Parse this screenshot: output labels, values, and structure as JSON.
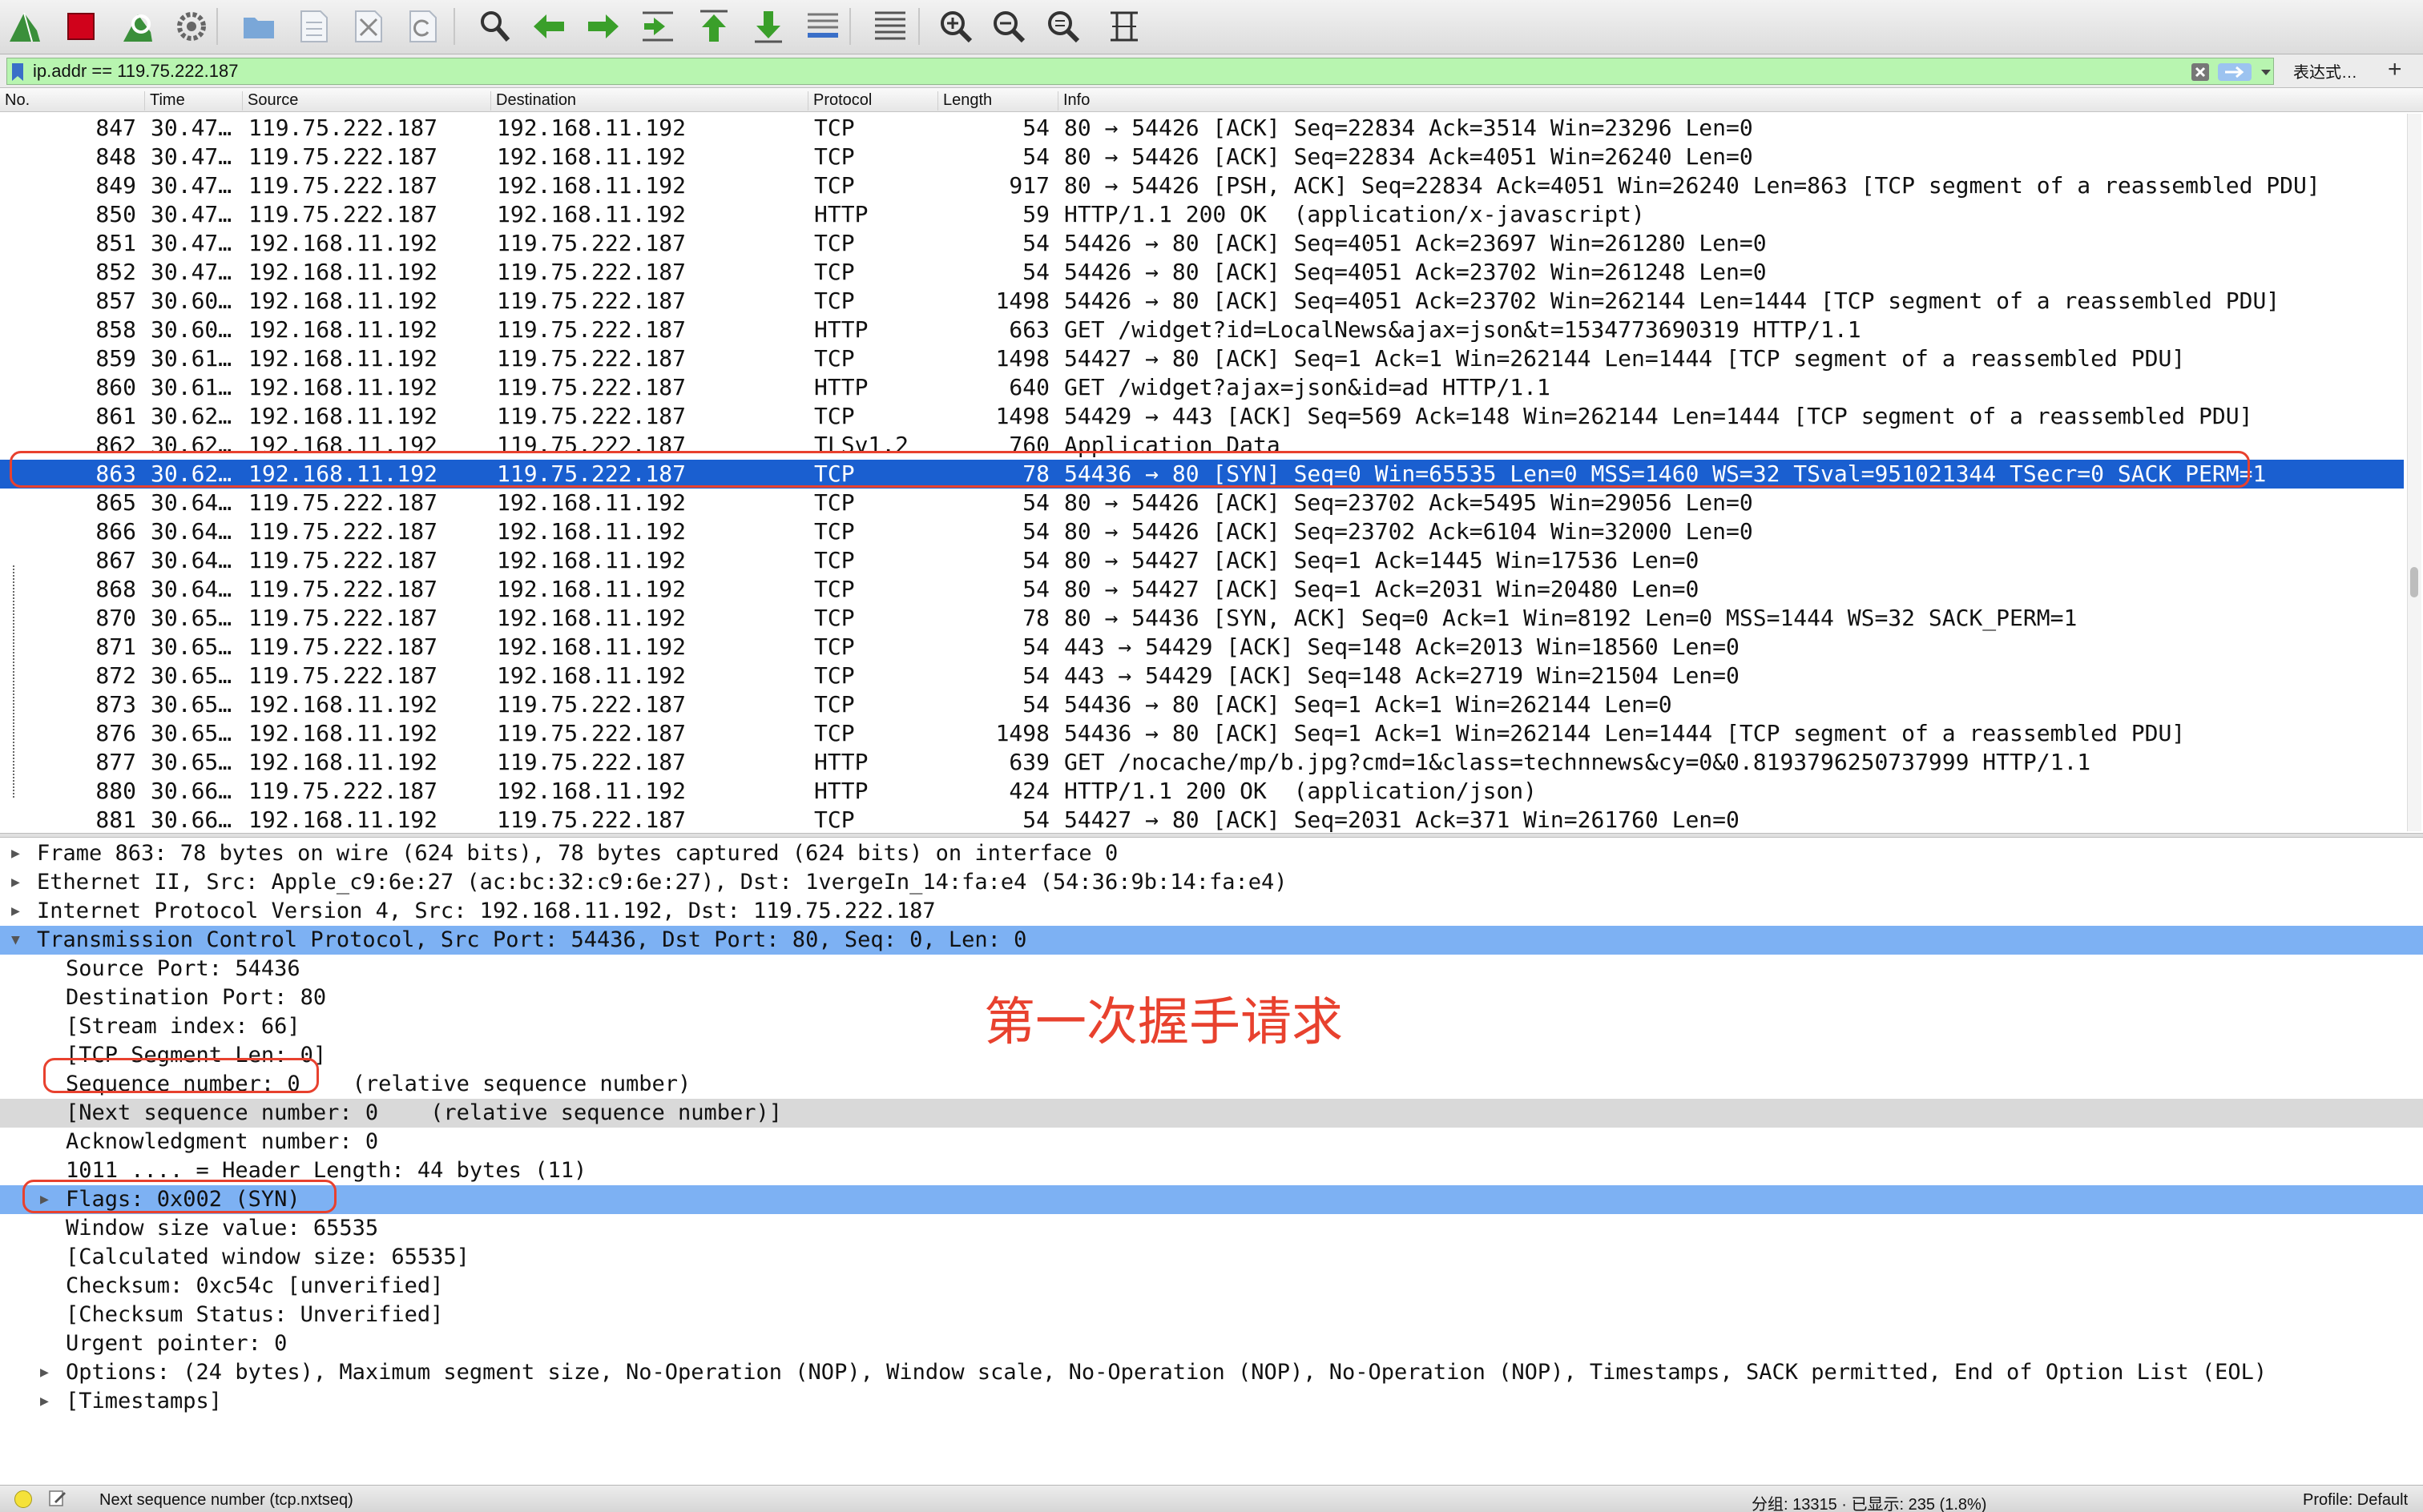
{
  "toolbar": {
    "buttons": [
      {
        "name": "start-capture-icon",
        "color": "#3a8f3a"
      },
      {
        "name": "stop-capture-icon",
        "color": "#d0021b"
      },
      {
        "name": "restart-capture-icon",
        "color": "#3a8f3a"
      },
      {
        "name": "capture-options-icon",
        "color": "#666666"
      },
      {
        "name": "open-file-icon",
        "color": "#7aa7d8"
      },
      {
        "name": "save-file-icon",
        "color": "#b0b8c4"
      },
      {
        "name": "close-file-icon",
        "color": "#b0b8c4"
      },
      {
        "name": "reload-file-icon",
        "color": "#b0b8c4"
      },
      {
        "name": "find-packet-icon",
        "color": "#333333"
      },
      {
        "name": "go-back-icon",
        "color": "#3a9f2a"
      },
      {
        "name": "go-forward-icon",
        "color": "#3a9f2a"
      },
      {
        "name": "go-to-packet-icon",
        "color": "#3a9f2a"
      },
      {
        "name": "first-packet-icon",
        "color": "#3a9f2a"
      },
      {
        "name": "last-packet-icon",
        "color": "#3a9f2a"
      },
      {
        "name": "auto-scroll-icon",
        "color": "#3a6fc8"
      },
      {
        "name": "colorize-icon",
        "color": "#555555"
      },
      {
        "name": "zoom-in-icon",
        "color": "#333333"
      },
      {
        "name": "zoom-out-icon",
        "color": "#333333"
      },
      {
        "name": "normal-size-icon",
        "color": "#333333"
      },
      {
        "name": "resize-columns-icon",
        "color": "#333333"
      }
    ]
  },
  "filter": {
    "value": "ip.addr == 119.75.222.187",
    "expression_label": "表达式…",
    "add_label": "+",
    "color": "#b8f5b0"
  },
  "packet_list": {
    "columns": [
      "No.",
      "Time",
      "Source",
      "Destination",
      "Protocol",
      "Length",
      "Info"
    ],
    "selected_color": "#1a5fd0",
    "rows": [
      {
        "no": "847",
        "time": "30.47…",
        "src": "119.75.222.187",
        "dst": "192.168.11.192",
        "proto": "TCP",
        "len": "54",
        "info": "80 → 54426 [ACK] Seq=22834 Ack=3514 Win=23296 Len=0"
      },
      {
        "no": "848",
        "time": "30.47…",
        "src": "119.75.222.187",
        "dst": "192.168.11.192",
        "proto": "TCP",
        "len": "54",
        "info": "80 → 54426 [ACK] Seq=22834 Ack=4051 Win=26240 Len=0"
      },
      {
        "no": "849",
        "time": "30.47…",
        "src": "119.75.222.187",
        "dst": "192.168.11.192",
        "proto": "TCP",
        "len": "917",
        "info": "80 → 54426 [PSH, ACK] Seq=22834 Ack=4051 Win=26240 Len=863 [TCP segment of a reassembled PDU]"
      },
      {
        "no": "850",
        "time": "30.47…",
        "src": "119.75.222.187",
        "dst": "192.168.11.192",
        "proto": "HTTP",
        "len": "59",
        "info": "HTTP/1.1 200 OK  (application/x-javascript)"
      },
      {
        "no": "851",
        "time": "30.47…",
        "src": "192.168.11.192",
        "dst": "119.75.222.187",
        "proto": "TCP",
        "len": "54",
        "info": "54426 → 80 [ACK] Seq=4051 Ack=23697 Win=261280 Len=0"
      },
      {
        "no": "852",
        "time": "30.47…",
        "src": "192.168.11.192",
        "dst": "119.75.222.187",
        "proto": "TCP",
        "len": "54",
        "info": "54426 → 80 [ACK] Seq=4051 Ack=23702 Win=261248 Len=0"
      },
      {
        "no": "857",
        "time": "30.60…",
        "src": "192.168.11.192",
        "dst": "119.75.222.187",
        "proto": "TCP",
        "len": "1498",
        "info": "54426 → 80 [ACK] Seq=4051 Ack=23702 Win=262144 Len=1444 [TCP segment of a reassembled PDU]"
      },
      {
        "no": "858",
        "time": "30.60…",
        "src": "192.168.11.192",
        "dst": "119.75.222.187",
        "proto": "HTTP",
        "len": "663",
        "info": "GET /widget?id=LocalNews&ajax=json&t=1534773690319 HTTP/1.1"
      },
      {
        "no": "859",
        "time": "30.61…",
        "src": "192.168.11.192",
        "dst": "119.75.222.187",
        "proto": "TCP",
        "len": "1498",
        "info": "54427 → 80 [ACK] Seq=1 Ack=1 Win=262144 Len=1444 [TCP segment of a reassembled PDU]"
      },
      {
        "no": "860",
        "time": "30.61…",
        "src": "192.168.11.192",
        "dst": "119.75.222.187",
        "proto": "HTTP",
        "len": "640",
        "info": "GET /widget?ajax=json&id=ad HTTP/1.1"
      },
      {
        "no": "861",
        "time": "30.62…",
        "src": "192.168.11.192",
        "dst": "119.75.222.187",
        "proto": "TCP",
        "len": "1498",
        "info": "54429 → 443 [ACK] Seq=569 Ack=148 Win=262144 Len=1444 [TCP segment of a reassembled PDU]"
      },
      {
        "no": "862",
        "time": "30.62…",
        "src": "192.168.11.192",
        "dst": "119.75.222.187",
        "proto": "TLSv1.2",
        "len": "760",
        "info": "Application Data"
      },
      {
        "no": "863",
        "time": "30.62…",
        "src": "192.168.11.192",
        "dst": "119.75.222.187",
        "proto": "TCP",
        "len": "78",
        "info": "54436 → 80 [SYN] Seq=0 Win=65535 Len=0 MSS=1460 WS=32 TSval=951021344 TSecr=0 SACK_PERM=1",
        "selected": true
      },
      {
        "no": "865",
        "time": "30.64…",
        "src": "119.75.222.187",
        "dst": "192.168.11.192",
        "proto": "TCP",
        "len": "54",
        "info": "80 → 54426 [ACK] Seq=23702 Ack=5495 Win=29056 Len=0"
      },
      {
        "no": "866",
        "time": "30.64…",
        "src": "119.75.222.187",
        "dst": "192.168.11.192",
        "proto": "TCP",
        "len": "54",
        "info": "80 → 54426 [ACK] Seq=23702 Ack=6104 Win=32000 Len=0"
      },
      {
        "no": "867",
        "time": "30.64…",
        "src": "119.75.222.187",
        "dst": "192.168.11.192",
        "proto": "TCP",
        "len": "54",
        "info": "80 → 54427 [ACK] Seq=1 Ack=1445 Win=17536 Len=0"
      },
      {
        "no": "868",
        "time": "30.64…",
        "src": "119.75.222.187",
        "dst": "192.168.11.192",
        "proto": "TCP",
        "len": "54",
        "info": "80 → 54427 [ACK] Seq=1 Ack=2031 Win=20480 Len=0"
      },
      {
        "no": "870",
        "time": "30.65…",
        "src": "119.75.222.187",
        "dst": "192.168.11.192",
        "proto": "TCP",
        "len": "78",
        "info": "80 → 54436 [SYN, ACK] Seq=0 Ack=1 Win=8192 Len=0 MSS=1444 WS=32 SACK_PERM=1"
      },
      {
        "no": "871",
        "time": "30.65…",
        "src": "119.75.222.187",
        "dst": "192.168.11.192",
        "proto": "TCP",
        "len": "54",
        "info": "443 → 54429 [ACK] Seq=148 Ack=2013 Win=18560 Len=0"
      },
      {
        "no": "872",
        "time": "30.65…",
        "src": "119.75.222.187",
        "dst": "192.168.11.192",
        "proto": "TCP",
        "len": "54",
        "info": "443 → 54429 [ACK] Seq=148 Ack=2719 Win=21504 Len=0"
      },
      {
        "no": "873",
        "time": "30.65…",
        "src": "192.168.11.192",
        "dst": "119.75.222.187",
        "proto": "TCP",
        "len": "54",
        "info": "54436 → 80 [ACK] Seq=1 Ack=1 Win=262144 Len=0"
      },
      {
        "no": "876",
        "time": "30.65…",
        "src": "192.168.11.192",
        "dst": "119.75.222.187",
        "proto": "TCP",
        "len": "1498",
        "info": "54436 → 80 [ACK] Seq=1 Ack=1 Win=262144 Len=1444 [TCP segment of a reassembled PDU]"
      },
      {
        "no": "877",
        "time": "30.65…",
        "src": "192.168.11.192",
        "dst": "119.75.222.187",
        "proto": "HTTP",
        "len": "639",
        "info": "GET /nocache/mp/b.jpg?cmd=1&class=technnews&cy=0&0.8193796250737999 HTTP/1.1"
      },
      {
        "no": "880",
        "time": "30.66…",
        "src": "119.75.222.187",
        "dst": "192.168.11.192",
        "proto": "HTTP",
        "len": "424",
        "info": "HTTP/1.1 200 OK  (application/json)"
      },
      {
        "no": "881",
        "time": "30.66…",
        "src": "192.168.11.192",
        "dst": "119.75.222.187",
        "proto": "TCP",
        "len": "54",
        "info": "54427 → 80 [ACK] Seq=2031 Ack=371 Win=261760 Len=0"
      }
    ]
  },
  "details": {
    "highlight_color": "#7db1f3",
    "rows": [
      {
        "text": "Frame 863: 78 bytes on wire (624 bits), 78 bytes captured (624 bits) on interface 0",
        "indent": 0,
        "expander": "collapsed"
      },
      {
        "text": "Ethernet II, Src: Apple_c9:6e:27 (ac:bc:32:c9:6e:27), Dst: 1vergeIn_14:fa:e4 (54:36:9b:14:fa:e4)",
        "indent": 0,
        "expander": "collapsed"
      },
      {
        "text": "Internet Protocol Version 4, Src: 192.168.11.192, Dst: 119.75.222.187",
        "indent": 0,
        "expander": "collapsed"
      },
      {
        "text": "Transmission Control Protocol, Src Port: 54436, Dst Port: 80, Seq: 0, Len: 0",
        "indent": 0,
        "expander": "expanded",
        "style": "hl"
      },
      {
        "text": "Source Port: 54436",
        "indent": 1
      },
      {
        "text": "Destination Port: 80",
        "indent": 1
      },
      {
        "text": "[Stream index: 66]",
        "indent": 1
      },
      {
        "text": "[TCP Segment Len: 0]",
        "indent": 1
      },
      {
        "text": "Sequence number: 0    (relative sequence number)",
        "indent": 1
      },
      {
        "text": "[Next sequence number: 0    (relative sequence number)]",
        "indent": 1,
        "style": "gray"
      },
      {
        "text": "Acknowledgment number: 0",
        "indent": 1
      },
      {
        "text": "1011 .... = Header Length: 44 bytes (11)",
        "indent": 1
      },
      {
        "text": "Flags: 0x002 (SYN)",
        "indent": 1,
        "expander": "collapsed",
        "style": "hl"
      },
      {
        "text": "Window size value: 65535",
        "indent": 1
      },
      {
        "text": "[Calculated window size: 65535]",
        "indent": 1
      },
      {
        "text": "Checksum: 0xc54c [unverified]",
        "indent": 1
      },
      {
        "text": "[Checksum Status: Unverified]",
        "indent": 1
      },
      {
        "text": "Urgent pointer: 0",
        "indent": 1
      },
      {
        "text": "Options: (24 bytes), Maximum segment size, No-Operation (NOP), Window scale, No-Operation (NOP), No-Operation (NOP), Timestamps, SACK permitted, End of Option List (EOL)",
        "indent": 1,
        "expander": "collapsed"
      },
      {
        "text": "[Timestamps]",
        "indent": 1,
        "expander": "collapsed"
      }
    ]
  },
  "annotation": {
    "text": "第一次握手请求",
    "color": "#e8412e"
  },
  "statusbar": {
    "field_text": "Next sequence number (tcp.nxtseq)",
    "counts_text": "分组: 13315 · 已显示: 235 (1.8%)",
    "profile_text": "Profile: Default"
  }
}
